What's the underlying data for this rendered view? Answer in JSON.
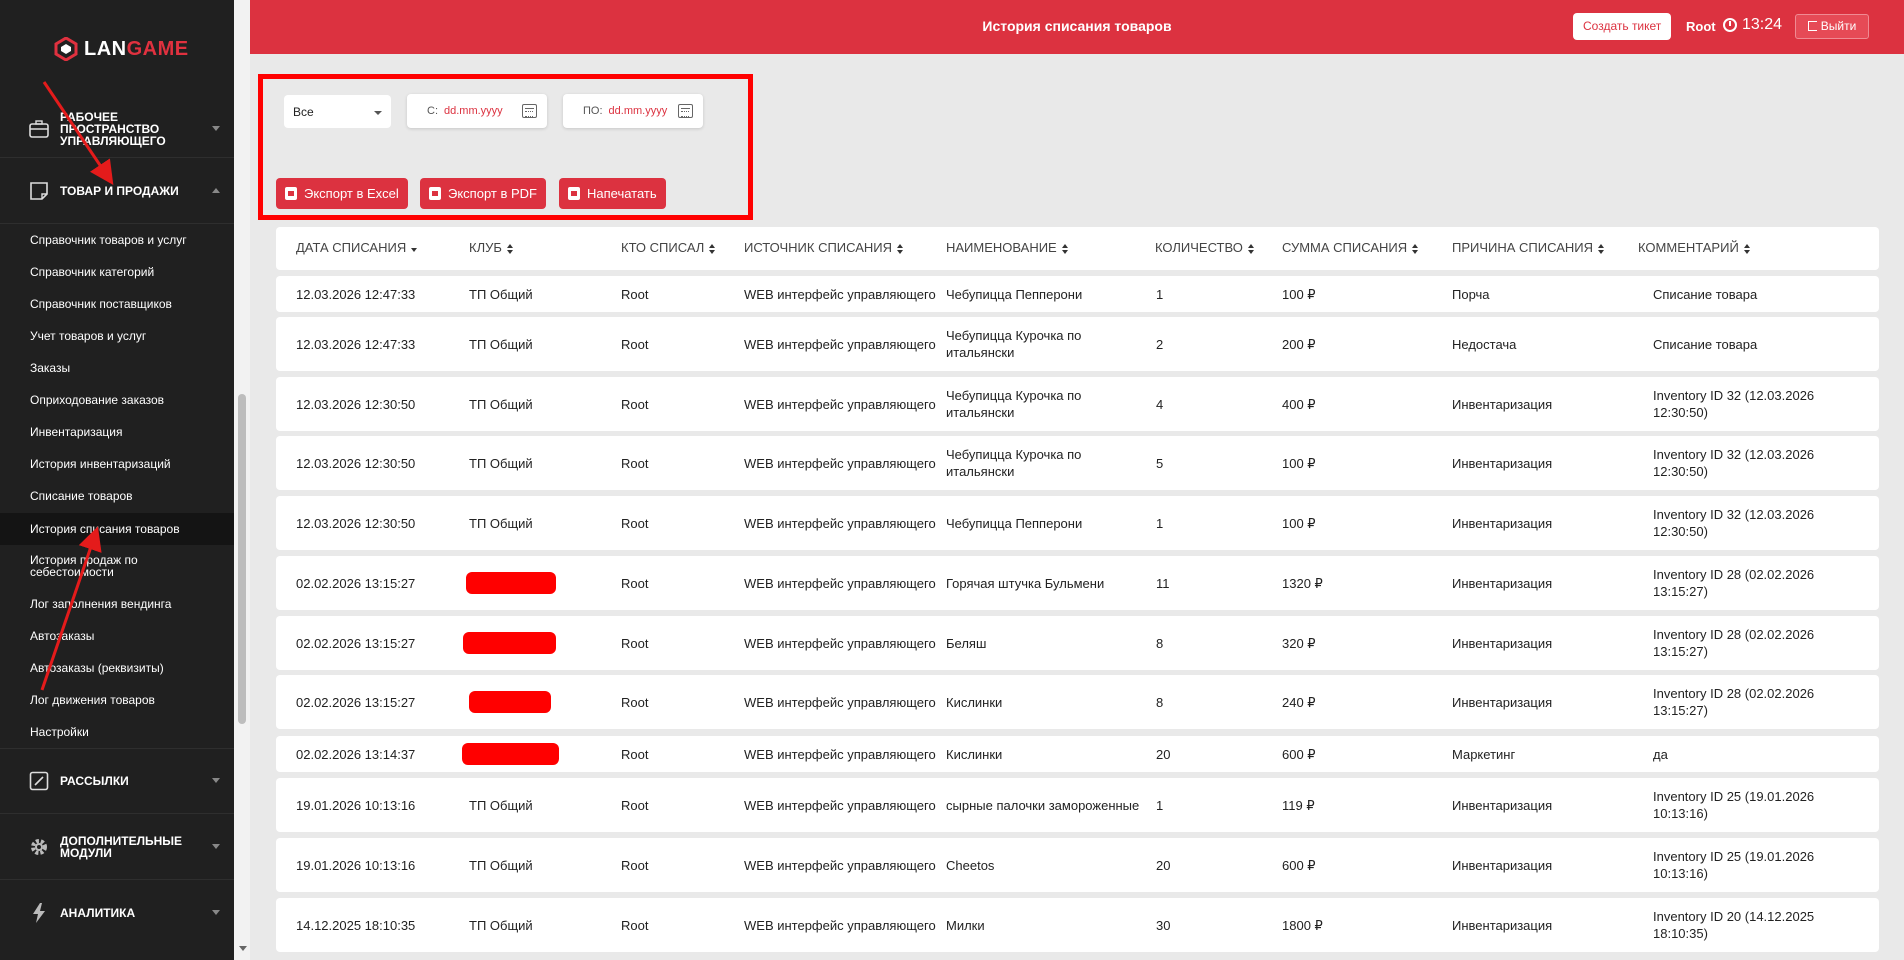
{
  "app": {
    "logo_text_white": "LAN",
    "logo_text_red": "GAME",
    "title": "История списания товаров"
  },
  "header": {
    "ticket_button": "Создать тикет",
    "user": "Root",
    "time": "13:24",
    "logout": "Выйти"
  },
  "sidebar": {
    "sections": [
      {
        "label": "Рабочее пространство управляющего",
        "icon": "briefcase-icon"
      },
      {
        "label": "Товар и продажи",
        "icon": "note-icon"
      },
      {
        "label": "Рассылки",
        "icon": "edit-icon"
      },
      {
        "label": "Дополнительные модули",
        "icon": "gear-icon"
      },
      {
        "label": "Аналитика",
        "icon": "lightning-icon"
      }
    ],
    "items": [
      "Справочник товаров и услуг",
      "Справочник категорий",
      "Справочник поставщиков",
      "Учет товаров и услуг",
      "Заказы",
      "Оприходование заказов",
      "Инвентаризация",
      "История инвентаризаций",
      "Списание товаров",
      "История списания товаров",
      "История продаж по себестоимости",
      "Лог заполнения вендинга",
      "Автозаказы",
      "Автозаказы (реквизиты)",
      "Лог движения товаров",
      "Настройки"
    ],
    "active_item": "История списания товаров"
  },
  "filters": {
    "select_value": "Все",
    "from_prefix": "С:",
    "from_placeholder": "dd.mm.yyyy",
    "to_prefix": "ПО:",
    "to_placeholder": "dd.mm.yyyy",
    "export_excel": "Экспорт в Excel",
    "export_pdf": "Экспорт в PDF",
    "print": "Напечатать"
  },
  "table": {
    "columns": [
      "Дата списания",
      "Клуб",
      "Кто списал",
      "Источник списания",
      "Наименование",
      "Количество",
      "Сумма списания",
      "Причина списания",
      "Комментарий"
    ],
    "rows": [
      {
        "date": "12.03.2026 12:47:33",
        "club": "ТП Общий",
        "who": "Root",
        "source": "WEB интерфейс управляющего",
        "name": "Чебупицца Пепперони",
        "qty": "1",
        "sum": "100 ₽",
        "reason": "Порча",
        "comment": "Списание товара"
      },
      {
        "date": "12.03.2026 12:47:33",
        "club": "ТП Общий",
        "who": "Root",
        "source": "WEB интерфейс управляющего",
        "name": "Чебупицца Курочка по итальянски",
        "qty": "2",
        "sum": "200 ₽",
        "reason": "Недостача",
        "comment": "Списание товара"
      },
      {
        "date": "12.03.2026 12:30:50",
        "club": "ТП Общий",
        "who": "Root",
        "source": "WEB интерфейс управляющего",
        "name": "Чебупицца Курочка по итальянски",
        "qty": "4",
        "sum": "400 ₽",
        "reason": "Инвентаризация",
        "comment": "Inventory ID 32 (12.03.2026 12:30:50)"
      },
      {
        "date": "12.03.2026 12:30:50",
        "club": "ТП Общий",
        "who": "Root",
        "source": "WEB интерфейс управляющего",
        "name": "Чебупицца Курочка по итальянски",
        "qty": "5",
        "sum": "100 ₽",
        "reason": "Инвентаризация",
        "comment": "Inventory ID 32 (12.03.2026 12:30:50)"
      },
      {
        "date": "12.03.2026 12:30:50",
        "club": "ТП Общий",
        "who": "Root",
        "source": "WEB интерфейс управляющего",
        "name": "Чебупицца Пепперони",
        "qty": "1",
        "sum": "100 ₽",
        "reason": "Инвентаризация",
        "comment": "Inventory ID 32 (12.03.2026 12:30:50)"
      },
      {
        "date": "02.02.2026 13:15:27",
        "club": "",
        "who": "Root",
        "source": "WEB интерфейс управляющего",
        "name": "Горячая штучка Бульмени",
        "qty": "11",
        "sum": "1320 ₽",
        "reason": "Инвентаризация",
        "comment": "Inventory ID 28 (02.02.2026 13:15:27)"
      },
      {
        "date": "02.02.2026 13:15:27",
        "club": "",
        "who": "Root",
        "source": "WEB интерфейс управляющего",
        "name": "Беляш",
        "qty": "8",
        "sum": "320 ₽",
        "reason": "Инвентаризация",
        "comment": "Inventory ID 28 (02.02.2026 13:15:27)"
      },
      {
        "date": "02.02.2026 13:15:27",
        "club": "",
        "who": "Root",
        "source": "WEB интерфейс управляющего",
        "name": "Кислинки",
        "qty": "8",
        "sum": "240 ₽",
        "reason": "Инвентаризация",
        "comment": "Inventory ID 28 (02.02.2026 13:15:27)"
      },
      {
        "date": "02.02.2026 13:14:37",
        "club": "",
        "who": "Root",
        "source": "WEB интерфейс управляющего",
        "name": "Кислинки",
        "qty": "20",
        "sum": "600 ₽",
        "reason": "Маркетинг",
        "comment": "да"
      },
      {
        "date": "19.01.2026 10:13:16",
        "club": "ТП Общий",
        "who": "Root",
        "source": "WEB интерфейс управляющего",
        "name": "сырные палочки замороженные",
        "qty": "1",
        "sum": "119 ₽",
        "reason": "Инвентаризация",
        "comment": "Inventory ID 25 (19.01.2026 10:13:16)"
      },
      {
        "date": "19.01.2026 10:13:16",
        "club": "ТП Общий",
        "who": "Root",
        "source": "WEB интерфейс управляющего",
        "name": "Cheetos",
        "qty": "20",
        "sum": "600 ₽",
        "reason": "Инвентаризация",
        "comment": "Inventory ID 25 (19.01.2026 10:13:16)"
      },
      {
        "date": "14.12.2025 18:10:35",
        "club": "ТП Общий",
        "who": "Root",
        "source": "WEB интерфейс управляющего",
        "name": "Милки",
        "qty": "30",
        "sum": "1800 ₽",
        "reason": "Инвентаризация",
        "comment": "Inventory ID 20 (14.12.2025 18:10:35)"
      }
    ]
  },
  "colors": {
    "brand_red": "#dc3240",
    "sidebar_bg": "#202020",
    "annotation_red": "#ff0000"
  }
}
